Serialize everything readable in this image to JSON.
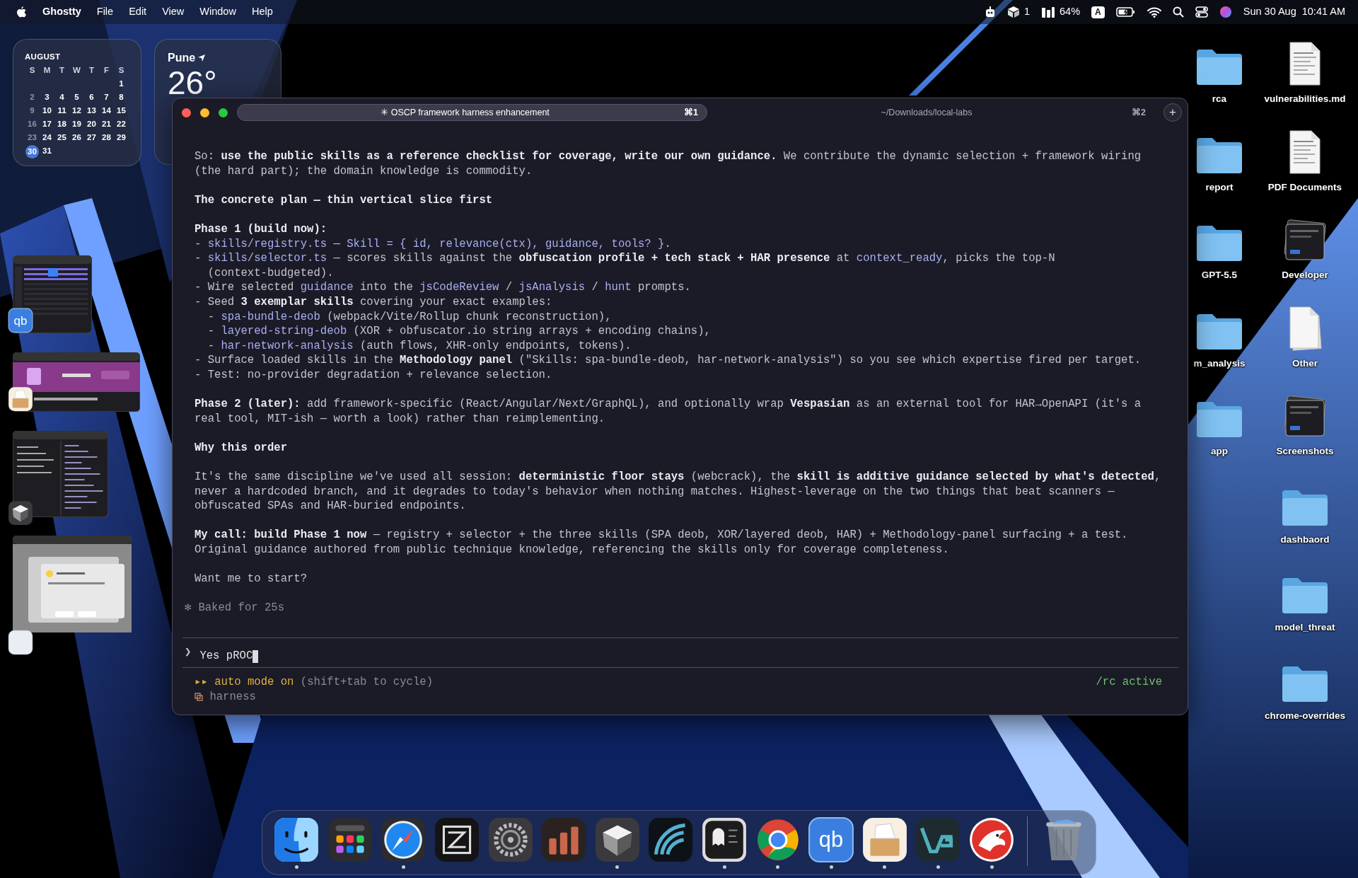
{
  "wallpaper": {
    "kind": "picture"
  },
  "menu_bar": {
    "app": "Ghostty",
    "menus": [
      "File",
      "Edit",
      "View",
      "Window",
      "Help"
    ],
    "status": [
      {
        "kind": "robot"
      },
      {
        "kind": "cube",
        "text": "1"
      },
      {
        "kind": "meter",
        "text": "64%"
      },
      {
        "kind": "input",
        "text": "A"
      },
      {
        "kind": "battery"
      },
      {
        "kind": "wifi"
      },
      {
        "kind": "search"
      },
      {
        "kind": "control"
      },
      {
        "kind": "siri"
      }
    ],
    "date": "Sun 30 Aug",
    "time": "10:41 AM"
  },
  "calendar": {
    "month": "AUGUST",
    "weekdays": [
      "S",
      "M",
      "T",
      "W",
      "T",
      "F",
      "S"
    ],
    "weeks": [
      [
        {
          "day": "1",
          "today": false
        }
      ],
      [
        {
          "day": "2",
          "today": false
        },
        {
          "day": "3",
          "today": false
        },
        {
          "day": "4",
          "today": false
        },
        {
          "day": "5",
          "today": false
        },
        {
          "day": "6",
          "today": false
        },
        {
          "day": "7",
          "today": false
        },
        {
          "day": "8",
          "today": false
        }
      ],
      [
        {
          "day": "9",
          "today": false
        },
        {
          "day": "10",
          "today": false
        },
        {
          "day": "11",
          "today": false
        },
        {
          "day": "12",
          "today": false
        },
        {
          "day": "13",
          "today": false
        },
        {
          "day": "14",
          "today": false
        },
        {
          "day": "15",
          "today": false
        }
      ],
      [
        {
          "day": "16",
          "today": false
        },
        {
          "day": "17",
          "today": false
        },
        {
          "day": "18",
          "today": false
        },
        {
          "day": "19",
          "today": false
        },
        {
          "day": "20",
          "today": false
        },
        {
          "day": "21",
          "today": false
        },
        {
          "day": "22",
          "today": false
        }
      ],
      [
        {
          "day": "23",
          "today": false
        },
        {
          "day": "24",
          "today": false
        },
        {
          "day": "25",
          "today": false
        },
        {
          "day": "26",
          "today": false
        },
        {
          "day": "27",
          "today": false
        },
        {
          "day": "28",
          "today": false
        },
        {
          "day": "29",
          "today": false
        }
      ],
      [
        {
          "day": "30",
          "today": true
        },
        {
          "day": "31",
          "today": false
        }
      ]
    ]
  },
  "weather": {
    "city": "Pune",
    "temperature": "26°"
  },
  "stage_manager": [
    {
      "kind": "torrent",
      "app": {
        "kind": "qb",
        "label": "qb"
      }
    },
    {
      "kind": "archive",
      "app": {
        "kind": "unarchiver"
      }
    },
    {
      "kind": "editor",
      "app": {
        "kind": "cube"
      }
    },
    {
      "kind": "dialog",
      "app": {
        "kind": "blank"
      }
    }
  ],
  "terminal": {
    "tabs": [
      {
        "icon": "✳",
        "title": "OSCP framework harness enhancement",
        "shortcut": "⌘1",
        "selected": true
      },
      {
        "title": "~/Downloads/local-labs",
        "shortcut": "⌘2",
        "selected": false
      }
    ],
    "new_tab": "+",
    "blocks": [
      [
        [
          {
            "text": "So: ",
            "kind": "plain"
          },
          {
            "text": "use the public skills as a reference checklist for coverage, write our own guidance.",
            "kind": "bold"
          },
          {
            "text": " We contribute the dynamic selection + framework wiring",
            "kind": "plain"
          }
        ],
        [
          {
            "text": "(the hard part); the domain knowledge is commodity.",
            "kind": "plain"
          }
        ]
      ],
      [
        [
          {
            "text": "The concrete plan — thin vertical slice first",
            "kind": "bold"
          }
        ]
      ],
      [
        [
          {
            "text": "Phase 1 (build now):",
            "kind": "bold"
          }
        ],
        [
          {
            "text": "- ",
            "kind": "plain"
          },
          {
            "text": "skills/registry.ts",
            "kind": "code"
          },
          {
            "text": " — ",
            "kind": "plain"
          },
          {
            "text": "Skill = { id, relevance(ctx), guidance, tools? }",
            "kind": "code"
          },
          {
            "text": ".",
            "kind": "plain"
          }
        ],
        [
          {
            "text": "- ",
            "kind": "plain"
          },
          {
            "text": "skills/selector.ts",
            "kind": "code"
          },
          {
            "text": " — scores skills against the ",
            "kind": "plain"
          },
          {
            "text": "obfuscation profile + tech stack + HAR presence",
            "kind": "bold"
          },
          {
            "text": " at ",
            "kind": "plain"
          },
          {
            "text": "context_ready",
            "kind": "code"
          },
          {
            "text": ", picks the top-N",
            "kind": "plain"
          }
        ],
        [
          {
            "text": "  (context-budgeted).",
            "kind": "plain"
          }
        ],
        [
          {
            "text": "- Wire selected ",
            "kind": "plain"
          },
          {
            "text": "guidance",
            "kind": "code"
          },
          {
            "text": " into the ",
            "kind": "plain"
          },
          {
            "text": "jsCodeReview",
            "kind": "code"
          },
          {
            "text": " / ",
            "kind": "plain"
          },
          {
            "text": "jsAnalysis",
            "kind": "code"
          },
          {
            "text": " / ",
            "kind": "plain"
          },
          {
            "text": "hunt",
            "kind": "code"
          },
          {
            "text": " prompts.",
            "kind": "plain"
          }
        ],
        [
          {
            "text": "- Seed ",
            "kind": "plain"
          },
          {
            "text": "3 exemplar skills",
            "kind": "bold"
          },
          {
            "text": " covering your exact examples:",
            "kind": "plain"
          }
        ],
        [
          {
            "text": "  - ",
            "kind": "plain"
          },
          {
            "text": "spa-bundle-deob",
            "kind": "code"
          },
          {
            "text": " (webpack/Vite/Rollup chunk reconstruction),",
            "kind": "plain"
          }
        ],
        [
          {
            "text": "  - ",
            "kind": "plain"
          },
          {
            "text": "layered-string-deob",
            "kind": "code"
          },
          {
            "text": " (XOR + obfuscator.io string arrays + encoding chains),",
            "kind": "plain"
          }
        ],
        [
          {
            "text": "  - ",
            "kind": "plain"
          },
          {
            "text": "har-network-analysis",
            "kind": "code"
          },
          {
            "text": " (auth flows, XHR-only endpoints, tokens).",
            "kind": "plain"
          }
        ],
        [
          {
            "text": "- Surface loaded skills in the ",
            "kind": "plain"
          },
          {
            "text": "Methodology panel",
            "kind": "bold"
          },
          {
            "text": " (\"Skills: spa-bundle-deob, har-network-analysis\") so you see which expertise fired per target.",
            "kind": "plain"
          }
        ],
        [
          {
            "text": "- Test: no-provider degradation + relevance selection.",
            "kind": "plain"
          }
        ]
      ],
      [
        [
          {
            "text": "Phase 2 (later):",
            "kind": "bold"
          },
          {
            "text": " add framework-specific (React/Angular/Next/GraphQL), and optionally wrap ",
            "kind": "plain"
          },
          {
            "text": "Vespasian",
            "kind": "bold"
          },
          {
            "text": " as an external tool for HAR→OpenAPI (it's a",
            "kind": "plain"
          }
        ],
        [
          {
            "text": "real tool, MIT-ish — worth a look) rather than reimplementing.",
            "kind": "plain"
          }
        ]
      ],
      [
        [
          {
            "text": "Why this order",
            "kind": "bold"
          }
        ]
      ],
      [
        [
          {
            "text": "It's the same discipline we've used all session: ",
            "kind": "plain"
          },
          {
            "text": "deterministic floor stays",
            "kind": "bold"
          },
          {
            "text": " (webcrack), the ",
            "kind": "plain"
          },
          {
            "text": "skill is additive guidance selected by what's detected",
            "kind": "bold"
          },
          {
            "text": ",",
            "kind": "plain"
          }
        ],
        [
          {
            "text": "never a hardcoded branch, and it degrades to today's behavior when nothing matches. Highest-leverage on the two things that beat scanners —",
            "kind": "plain"
          }
        ],
        [
          {
            "text": "obfuscated SPAs and HAR-buried endpoints.",
            "kind": "plain"
          }
        ]
      ],
      [
        [
          {
            "text": "My call: build Phase 1 now",
            "kind": "bold"
          },
          {
            "text": " — registry + selector + the three skills (SPA deob, XOR/layered deob, HAR) + Methodology-panel surfacing + a test.",
            "kind": "plain"
          }
        ],
        [
          {
            "text": "Original guidance authored from public technique knowledge, referencing the skills only for coverage completeness.",
            "kind": "plain"
          }
        ]
      ],
      [
        [
          {
            "text": "Want me to start?",
            "kind": "plain"
          }
        ]
      ]
    ],
    "status": {
      "icon": "✻",
      "text": "Baked for 25s"
    },
    "prompt": {
      "symbol": "❯",
      "value": "Yes pROC"
    },
    "footer": {
      "mode_icon": "▸▸",
      "mode": "auto mode on",
      "mode_hint": "(shift+tab to cycle)",
      "remote": "/rc active",
      "branch": "harness"
    }
  },
  "desktop_icons": [
    [
      {
        "kind": "folder",
        "label": "rca"
      },
      {
        "kind": "folder",
        "label": "report"
      },
      {
        "kind": "folder",
        "label": "GPT-5.5"
      },
      {
        "kind": "folder",
        "label": "m_analysis"
      },
      {
        "kind": "folder",
        "label": "app"
      }
    ],
    [
      {
        "kind": "document",
        "label": "vulnerabilities.md"
      },
      {
        "kind": "document",
        "label": "PDF Documents"
      },
      {
        "kind": "stack",
        "label": "Developer"
      },
      {
        "kind": "unknown",
        "label": "Other"
      },
      {
        "kind": "stack",
        "label": "Screenshots"
      },
      {
        "kind": "folder",
        "label": "dashbaord"
      },
      {
        "kind": "folder",
        "label": "model_threat"
      },
      {
        "kind": "folder",
        "label": "chrome-overrides"
      }
    ]
  ],
  "dock": {
    "apps": [
      {
        "kind": "finder",
        "running": true
      },
      {
        "kind": "launchpad",
        "running": false
      },
      {
        "kind": "safari",
        "running": true
      },
      {
        "kind": "zed",
        "running": false
      },
      {
        "kind": "settings",
        "running": false
      },
      {
        "kind": "bars",
        "running": false
      },
      {
        "kind": "cube",
        "running": true
      },
      {
        "kind": "wave",
        "running": false
      },
      {
        "kind": "ghost",
        "running": true
      },
      {
        "kind": "chrome",
        "running": true
      },
      {
        "kind": "qb",
        "label": "qb",
        "running": true
      },
      {
        "kind": "unarchiver",
        "running": true
      },
      {
        "kind": "vs",
        "running": true
      },
      {
        "kind": "dragon",
        "running": true
      }
    ],
    "trash": {
      "kind": "trash"
    }
  }
}
